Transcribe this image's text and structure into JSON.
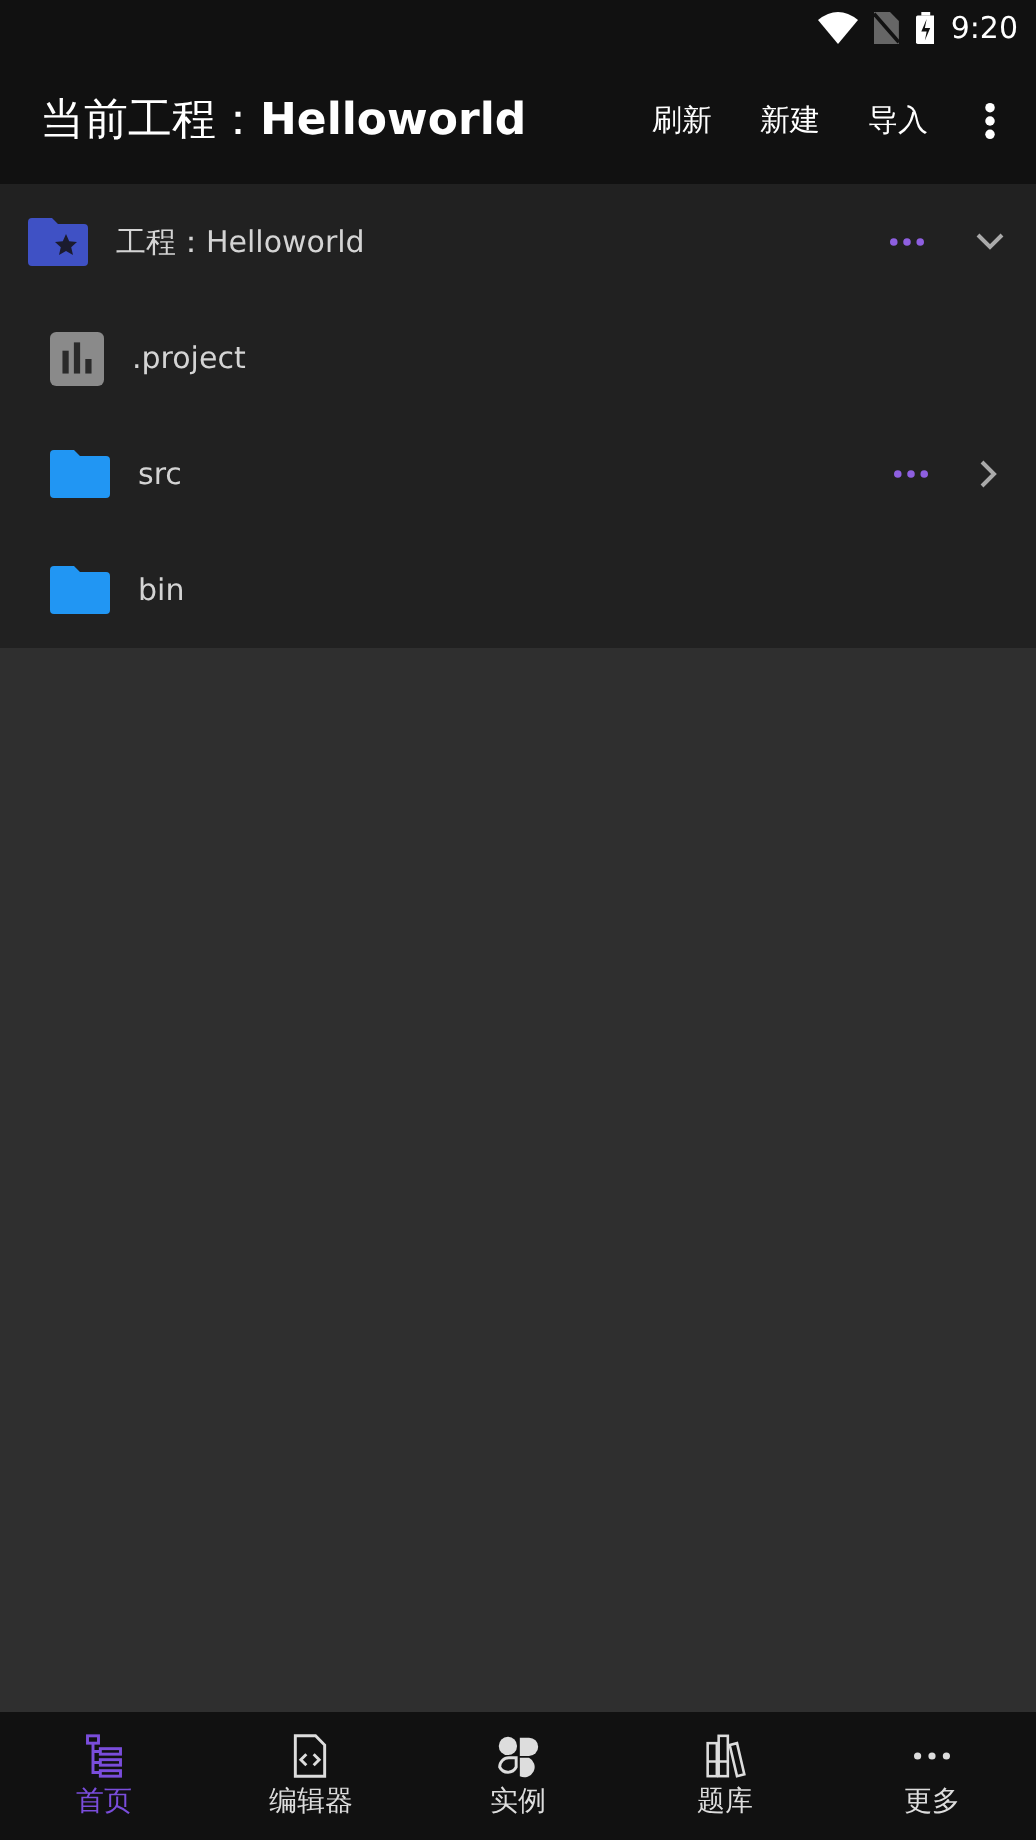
{
  "status_bar": {
    "time": "9:20"
  },
  "app_bar": {
    "title": "当前工程：**Helloworld**",
    "actions": [
      "刷新",
      "新建",
      "导入"
    ]
  },
  "tree": {
    "label": "工程：Helloworld",
    "kind": "project",
    "expanded": true,
    "children": [
      {
        "label": ".project",
        "kind": "file"
      },
      {
        "label": "src",
        "kind": "folder",
        "expanded": false
      },
      {
        "label": "bin",
        "kind": "folder"
      }
    ]
  },
  "bottom_nav": [
    {
      "label": "首页",
      "selected": true
    },
    {
      "label": "编辑器",
      "selected": false
    },
    {
      "label": "实例",
      "selected": false
    },
    {
      "label": "题库",
      "selected": false
    },
    {
      "label": "更多",
      "selected": false
    }
  ]
}
